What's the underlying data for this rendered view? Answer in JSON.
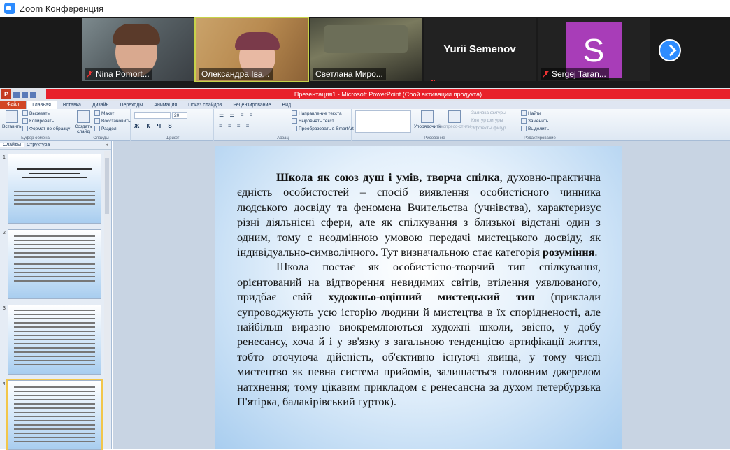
{
  "zoom": {
    "title": "Zoom Конференция",
    "participants": [
      {
        "name": "Nina Pomort...",
        "muted": true
      },
      {
        "name": "Олександра Іва...",
        "muted": false,
        "active": true
      },
      {
        "name": "Светлана Миро...",
        "muted": false
      },
      {
        "name": "Yurii Semenov",
        "muted": true,
        "video": false
      },
      {
        "name": "Sergej Taran...",
        "muted": true,
        "avatar_letter": "S",
        "avatar_color": "#a83db8"
      }
    ]
  },
  "powerpoint": {
    "title": "Презентация1 - Microsoft PowerPoint (Сбой активации продукта)",
    "tabs": [
      "Файл",
      "Главная",
      "Вставка",
      "Дизайн",
      "Переходы",
      "Анимация",
      "Показ слайдов",
      "Рецензирование",
      "Вид"
    ],
    "ribbon": {
      "clipboard": {
        "label": "Буфер обмена",
        "paste": "Вставить",
        "cut": "Вырезать",
        "copy": "Копировать",
        "format": "Формат по образцу"
      },
      "slides": {
        "label": "Слайды",
        "new_slide": "Создать слайд",
        "layout": "Макет",
        "reset": "Восстановить",
        "section": "Раздел"
      },
      "font": {
        "label": "Шрифт",
        "size": "20"
      },
      "paragraph": {
        "label": "Абзац",
        "direction": "Направление текста",
        "align": "Выровнять текст",
        "smartart": "Преобразовать в SmartArt"
      },
      "drawing": {
        "label": "Рисование",
        "arrange": "Упорядочить",
        "styles": "Экспресс-стили",
        "fill": "Заливка фигуры",
        "outline": "Контур фигуры",
        "effects": "Эффекты фигур"
      },
      "editing": {
        "label": "Редактирование",
        "find": "Найти",
        "replace": "Заменить",
        "select": "Выделить"
      }
    },
    "side_tabs": [
      "Слайды",
      "Структура"
    ],
    "slide_numbers": [
      "1",
      "2",
      "3",
      "4"
    ],
    "slide": {
      "p1_bold": "Школа як союз душ і умів, творча спілка",
      "p1_rest": ", духовно-практична єдність особистостей – спосіб виявлення  особистісного чинника людського досвіду та феномена Вчительства (учнівства), характеризує різні діяльнісні сфери, але як спілкування з близької відстані один з одним, тому є неодмінною умовою передачі мистецького досвіду, як індивідуально-символічного. Тут визначальною стає категорія ",
      "p1_bold2": "розуміння",
      "p1_end": ".",
      "p2_start": "Школа постає як особистісно-творчий тип спілкування, орієнтований на відтворення невидимих світів, втілення уявлюваного, придбає свій ",
      "p2_bold": "художньо-оцінний мистецький тип",
      "p2_rest": " (приклади супроводжують усю історію людини й мистецтва в їх спорідненості, але  найбільш виразно виокремлюються художні школи, звісно, у добу ренесансу, хоча й і у зв'язку з загальною тенденцією артифікації життя, тобто оточуюча дійсність, об'єктивно існуючі явища, у тому числі мистецтво як певна система прийомів, залишається головним джерелом натхнення; тому цікавим прикладом є ренесансна за духом петербурзька П'ятірка, балакірівський гурток)."
    }
  }
}
